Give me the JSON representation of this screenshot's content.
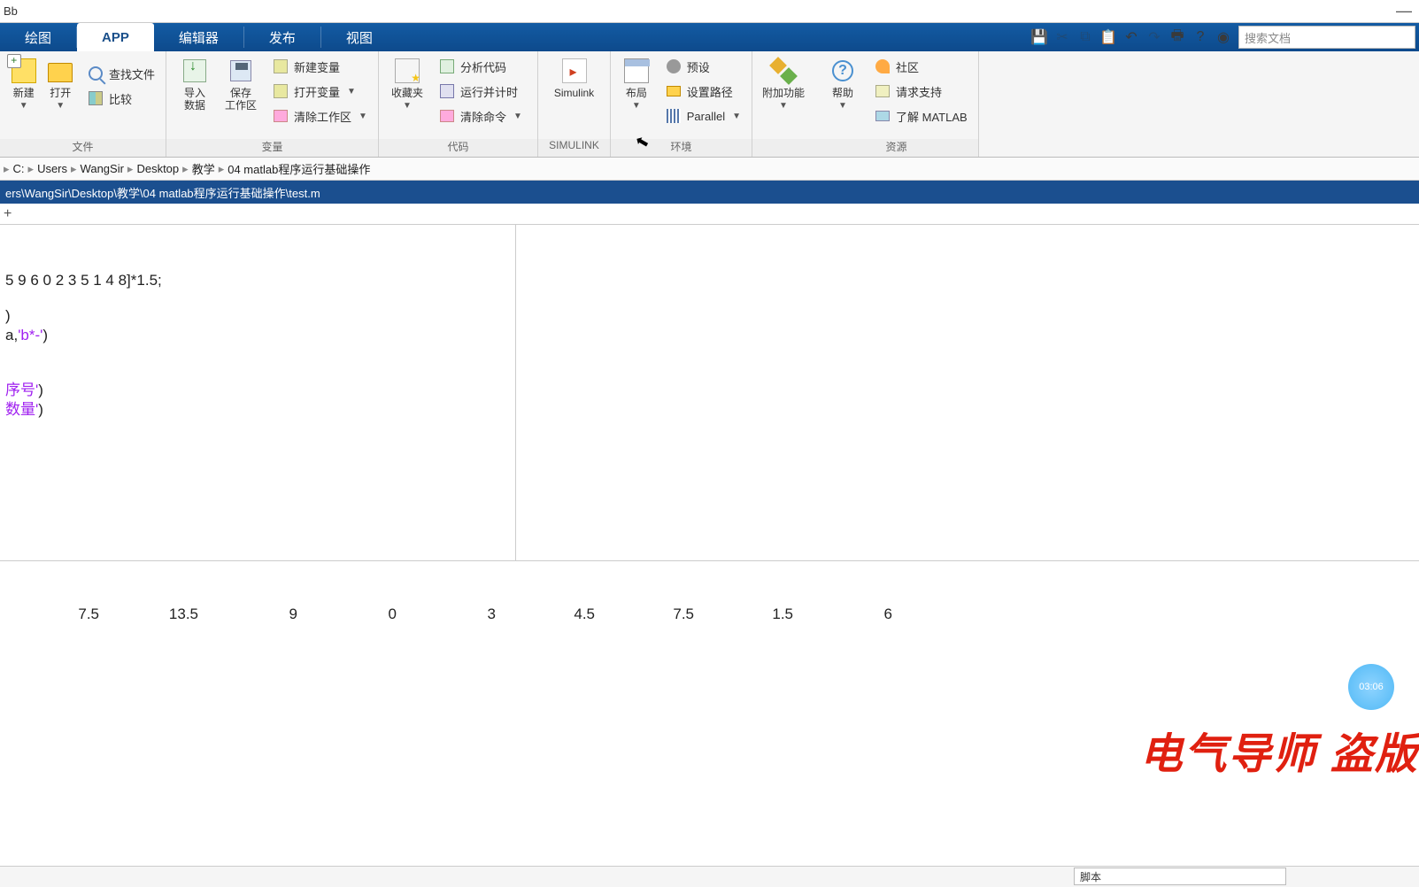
{
  "title": {
    "text": "Bb"
  },
  "tabs": {
    "plot": "绘图",
    "app": "APP",
    "editor": "编辑器",
    "publish": "发布",
    "view": "视图"
  },
  "search": {
    "placeholder": "搜索文档"
  },
  "ribbon": {
    "file": {
      "new": "新建",
      "open": "打开",
      "findfiles": "查找文件",
      "compare": "比较",
      "label": "文件"
    },
    "variable": {
      "import": "导入\n数据",
      "saveWs": "保存\n工作区",
      "newVar": "新建变量",
      "openVar": "打开变量",
      "clearWs": "清除工作区",
      "label": "变量"
    },
    "code": {
      "favorites": "收藏夹",
      "analyze": "分析代码",
      "runTime": "运行并计时",
      "clearCmd": "清除命令",
      "label": "代码"
    },
    "simulink": {
      "btn": "Simulink",
      "label": "SIMULINK"
    },
    "env": {
      "layout": "布局",
      "prefs": "预设",
      "setPath": "设置路径",
      "parallel": "Parallel",
      "label": "环境"
    },
    "addon": {
      "btn": "附加功能"
    },
    "resources": {
      "help": "帮助",
      "community": "社区",
      "support": "请求支持",
      "learn": "了解 MATLAB",
      "label": "资源"
    }
  },
  "breadcrumb": {
    "segs": [
      "C:",
      "Users",
      "WangSir",
      "Desktop",
      "教学",
      "04 matlab程序运行基础操作"
    ]
  },
  "editorTitle": "ers\\WangSir\\Desktop\\教学\\04 matlab程序运行基础操作\\test.m",
  "code": {
    "line1": "5 9 6 0 2 3 5 1 4 8]*1.5;",
    "line2": ")",
    "line3a": "a,",
    "line3b": "'b*-'",
    "line3c": ")",
    "line4a": "序号'",
    "line4b": ")",
    "line5a": "数量'",
    "line5b": ")"
  },
  "output": {
    "values": [
      "7.5",
      "13.5",
      "9",
      "0",
      "3",
      "4.5",
      "7.5",
      "1.5",
      "6"
    ]
  },
  "watermark": "电气导师 盗版",
  "timestamp": "03:06",
  "status": {
    "script": "脚本"
  }
}
